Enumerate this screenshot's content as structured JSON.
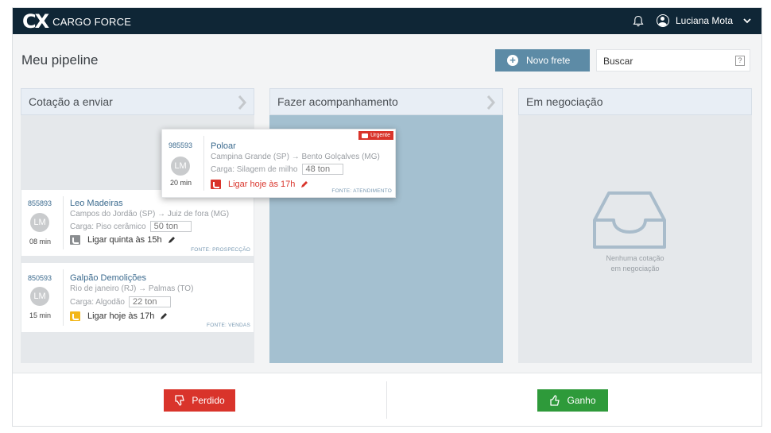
{
  "header": {
    "logo_mark": "CX",
    "logo_text": "CARGO FORCE",
    "user_name": "Luciana Mota"
  },
  "toolbar": {
    "page_title": "Meu pipeline",
    "new_button": "Novo frete",
    "search_placeholder": "Buscar",
    "help_glyph": "?"
  },
  "columns": [
    {
      "title": "Cotação a enviar"
    },
    {
      "title": "Fazer acompanhamento"
    },
    {
      "title": "Em negociação"
    }
  ],
  "cards": [
    {
      "id": "855893",
      "initials": "LM",
      "time": "08 min",
      "name": "Leo Madeiras",
      "route": "Campos do Jordão (SP) → Juiz de fora (MG)",
      "load_label": "Carga: Piso cerâmico",
      "tons": "50 ton",
      "action": "Ligar quinta às 15h",
      "source": "FONTE: PROSPECÇÃO",
      "phone_color": "#8a8d90"
    },
    {
      "id": "850593",
      "initials": "LM",
      "time": "15 min",
      "name": "Galpão Demolições",
      "route": "Rio de janeiro (RJ) → Palmas (TO)",
      "load_label": "Carga: Algodão",
      "tons": "22 ton",
      "action": "Ligar hoje às 17h",
      "source": "FONTE: VENDAS",
      "phone_color": "#f2b619"
    },
    {
      "id": "985593",
      "initials": "LM",
      "time": "20 min",
      "name": "Poloar",
      "route": "Campina Grande (SP) → Bento Golçalves (MG)",
      "load_label": "Carga: Silagem de milho",
      "tons": "48 ton",
      "action": "Ligar hoje às 17h",
      "source": "FONTE: ATENDIMENTO",
      "badge": "Urgente",
      "phone_color": "#d9342b"
    }
  ],
  "empty_state": {
    "line1": "Nenhuma cotação",
    "line2": "em negociação"
  },
  "footer": {
    "lost_label": "Perdido",
    "won_label": "Ganho"
  },
  "colors": {
    "header_bg": "#0f2636",
    "primary_button": "#5d8ba6",
    "danger": "#d9342b",
    "success": "#2e9a3a",
    "active_column": "#a4c0d0"
  }
}
